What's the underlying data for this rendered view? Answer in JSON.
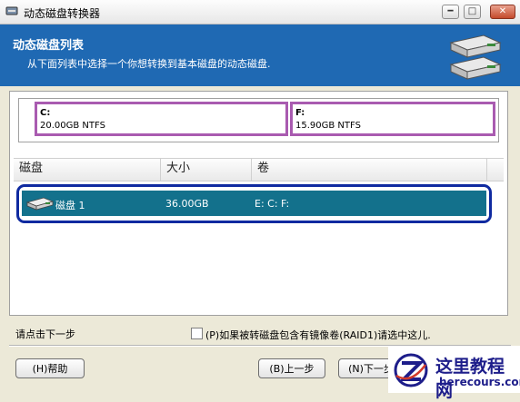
{
  "window": {
    "title": "动态磁盘转换器",
    "controls": {
      "minimize": "━",
      "maximize": "□",
      "close": "✕"
    }
  },
  "header": {
    "title": "动态磁盘列表",
    "subtitle": "从下面列表中选择一个你想转换到基本磁盘的动态磁盘."
  },
  "partitions": [
    {
      "letter": "C:",
      "info": "20.00GB NTFS"
    },
    {
      "letter": "F:",
      "info": "15.90GB NTFS"
    }
  ],
  "table": {
    "columns": [
      "磁盘",
      "大小",
      "卷"
    ],
    "rows": [
      {
        "disk": "磁盘 1",
        "size": "36.00GB",
        "volumes": "E:   C:   F:"
      }
    ]
  },
  "footer": {
    "hint": "请点击下一步",
    "raid_checkbox_label": "(P)如果被转磁盘包含有镜像卷(RAID1)请选中这儿.",
    "raid_checked": false
  },
  "buttons": {
    "help": "(H)帮助",
    "back": "(B)上一步",
    "next": "(N)下一步"
  },
  "watermark": {
    "cn": "这里教程网",
    "en": "herecours.com"
  },
  "colors": {
    "header_bg": "#1f69b3",
    "selection_bg": "#13718c",
    "selection_outline": "#0f2aa0",
    "partition_border": "#a95bb0"
  }
}
